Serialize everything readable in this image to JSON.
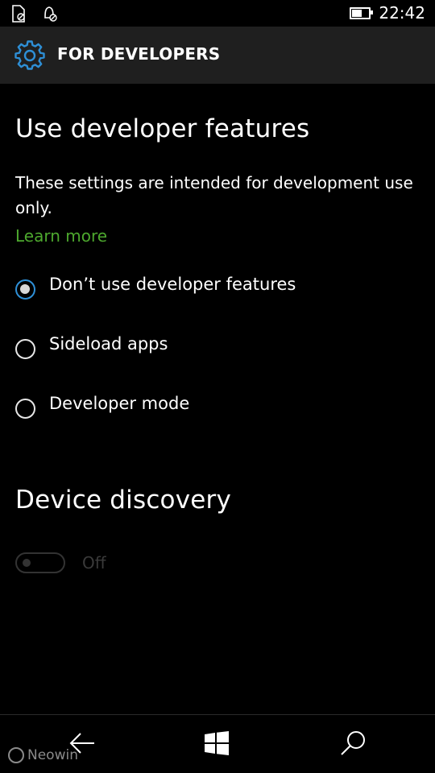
{
  "status_bar": {
    "time": "22:42",
    "left_icons": [
      "sim-icon",
      "notification-icon"
    ],
    "battery_level": 0.75
  },
  "header": {
    "icon": "gear-icon",
    "title": "FOR DEVELOPERS"
  },
  "developer_features": {
    "heading": "Use developer features",
    "description": "These settings are intended for development use only.",
    "learn_more": "Learn more",
    "options": [
      {
        "label": "Don’t use developer features",
        "selected": true
      },
      {
        "label": "Sideload apps",
        "selected": false
      },
      {
        "label": "Developer mode",
        "selected": false
      }
    ]
  },
  "device_discovery": {
    "heading": "Device discovery",
    "toggle_state": "Off",
    "enabled": false
  },
  "navbar": {
    "back_icon": "back-arrow-icon",
    "start_icon": "windows-logo-icon",
    "search_icon": "search-icon",
    "watermark": "Neowin"
  },
  "colors": {
    "accent": "#2e8fd6",
    "link": "#4da82e",
    "header_bg": "#1f1f1f"
  }
}
